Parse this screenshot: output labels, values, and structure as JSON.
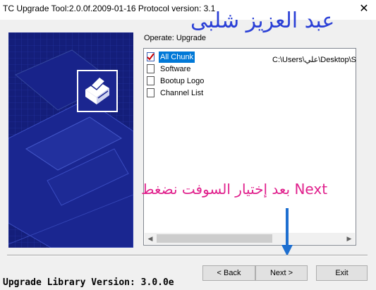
{
  "window": {
    "title": "TC Upgrade Tool:2.0.0f.2009-01-16 Protocol version: 3.1",
    "close_glyph": "✕"
  },
  "overlay": {
    "name_text": "عبد العزيز شلبى",
    "instruction_text": "بعد إختيار السوفت نضغط Next",
    "name_color": "#2a3fd6",
    "instruction_color": "#e0208c",
    "arrow_color": "#1e6fd0"
  },
  "side_panel": {
    "bg_color": "#141e7a",
    "logo_icon": "printer-logo-icon"
  },
  "operate": {
    "label": "Operate: Upgrade"
  },
  "chunk_list": {
    "items": [
      {
        "label": "All Chunk",
        "path": "C:\\Users\\علي\\Desktop\\S",
        "checked": true,
        "selected": true
      },
      {
        "label": "Software"
      },
      {
        "label": "Bootup Logo"
      },
      {
        "label": "Channel List"
      }
    ]
  },
  "footer": {
    "library_version": "Upgrade Library Version: 3.0.0e"
  },
  "buttons": {
    "back": "< Back",
    "next": "Next >",
    "exit": "Exit"
  }
}
